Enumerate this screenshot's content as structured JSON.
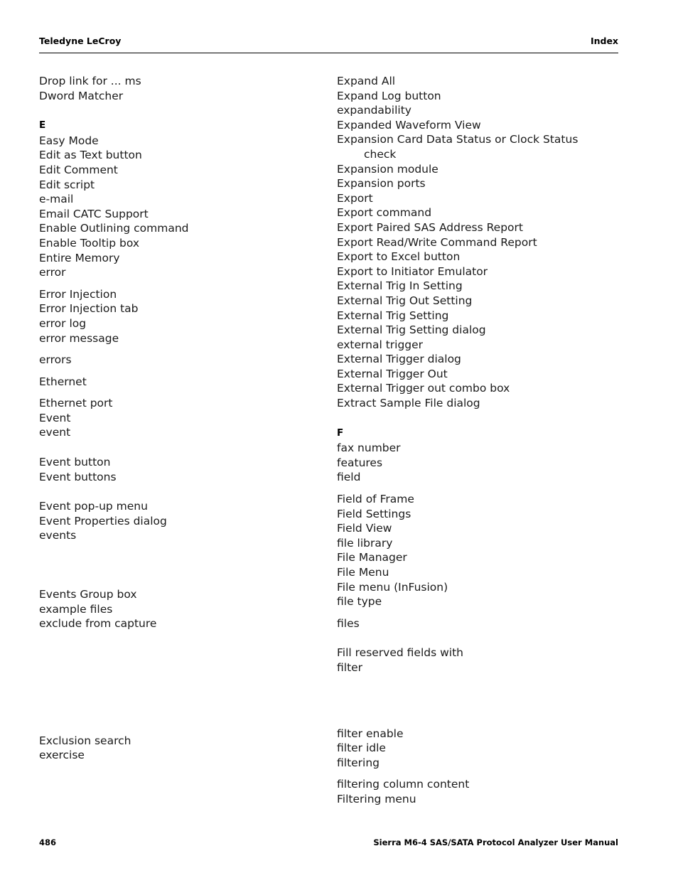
{
  "header": {
    "left": "Teledyne LeCroy",
    "right": "Index"
  },
  "footer": {
    "page_number": "486",
    "title": "Sierra M6-4 SAS/SATA Protocol Analyzer User Manual"
  },
  "left_column": [
    {
      "type": "entry",
      "text": "Drop link for ... ms"
    },
    {
      "type": "entry",
      "text": "Dword Matcher"
    },
    {
      "type": "letter",
      "text": "E"
    },
    {
      "type": "entry",
      "text": "Easy Mode"
    },
    {
      "type": "entry",
      "text": "Edit as Text button"
    },
    {
      "type": "entry",
      "text": "Edit Comment"
    },
    {
      "type": "entry",
      "text": "Edit script"
    },
    {
      "type": "entry",
      "text": "e-mail"
    },
    {
      "type": "entry",
      "text": "Email CATC Support"
    },
    {
      "type": "entry",
      "text": "Enable Outlining command"
    },
    {
      "type": "entry",
      "text": "Enable Tooltip box"
    },
    {
      "type": "entry",
      "text": "Entire Memory"
    },
    {
      "type": "entry",
      "text": "error"
    },
    {
      "type": "gap",
      "size": "gap-s"
    },
    {
      "type": "entry",
      "text": "Error Injection"
    },
    {
      "type": "entry",
      "text": "Error Injection tab"
    },
    {
      "type": "entry",
      "text": "error log"
    },
    {
      "type": "entry",
      "text": "error message"
    },
    {
      "type": "gap",
      "size": "gap-s"
    },
    {
      "type": "entry",
      "text": "errors"
    },
    {
      "type": "gap",
      "size": "gap-s"
    },
    {
      "type": "entry",
      "text": "Ethernet"
    },
    {
      "type": "gap",
      "size": "gap-s"
    },
    {
      "type": "entry",
      "text": "Ethernet port"
    },
    {
      "type": "entry",
      "text": "Event"
    },
    {
      "type": "entry",
      "text": "event"
    },
    {
      "type": "gap",
      "size": "gap-m"
    },
    {
      "type": "entry",
      "text": "Event button"
    },
    {
      "type": "entry",
      "text": "Event buttons"
    },
    {
      "type": "gap",
      "size": "gap-m"
    },
    {
      "type": "entry",
      "text": "Event pop-up menu"
    },
    {
      "type": "entry",
      "text": "Event Properties dialog"
    },
    {
      "type": "entry",
      "text": "events"
    },
    {
      "type": "gap",
      "size": "gap-xxl"
    },
    {
      "type": "entry",
      "text": "Events Group box"
    },
    {
      "type": "entry",
      "text": "example files"
    },
    {
      "type": "entry",
      "text": "exclude from capture"
    },
    {
      "type": "gap",
      "size": "gap-huge"
    },
    {
      "type": "gap",
      "size": "gap-m"
    },
    {
      "type": "entry",
      "text": "Exclusion search"
    },
    {
      "type": "entry",
      "text": "exercise"
    }
  ],
  "right_column": [
    {
      "type": "entry",
      "text": "Expand All"
    },
    {
      "type": "entry",
      "text": "Expand Log button"
    },
    {
      "type": "entry",
      "text": "expandability"
    },
    {
      "type": "entry",
      "text": "Expanded Waveform View"
    },
    {
      "type": "entry",
      "text": "Expansion Card Data Status or Clock Status"
    },
    {
      "type": "entry",
      "indent": true,
      "text": "check"
    },
    {
      "type": "entry",
      "text": "Expansion module"
    },
    {
      "type": "entry",
      "text": "Expansion ports"
    },
    {
      "type": "entry",
      "text": "Export"
    },
    {
      "type": "entry",
      "text": "Export command"
    },
    {
      "type": "entry",
      "text": "Export Paired SAS Address Report"
    },
    {
      "type": "entry",
      "text": "Export Read/Write Command Report"
    },
    {
      "type": "entry",
      "text": "Export to Excel button"
    },
    {
      "type": "entry",
      "text": "Export to Initiator Emulator"
    },
    {
      "type": "entry",
      "text": "External Trig In Setting"
    },
    {
      "type": "entry",
      "text": "External Trig Out Setting"
    },
    {
      "type": "entry",
      "text": "External Trig Setting"
    },
    {
      "type": "entry",
      "text": "External Trig Setting dialog"
    },
    {
      "type": "entry",
      "text": "external trigger"
    },
    {
      "type": "entry",
      "text": "External Trigger dialog"
    },
    {
      "type": "entry",
      "text": "External Trigger Out"
    },
    {
      "type": "entry",
      "text": "External Trigger out combo box"
    },
    {
      "type": "entry",
      "text": "Extract Sample File dialog"
    },
    {
      "type": "letter",
      "text": "F"
    },
    {
      "type": "entry",
      "text": "fax number"
    },
    {
      "type": "entry",
      "text": "features"
    },
    {
      "type": "entry",
      "text": "field"
    },
    {
      "type": "gap",
      "size": "gap-s"
    },
    {
      "type": "entry",
      "text": "Field of Frame"
    },
    {
      "type": "entry",
      "text": "Field Settings"
    },
    {
      "type": "entry",
      "text": "Field View"
    },
    {
      "type": "entry",
      "text": "file library"
    },
    {
      "type": "entry",
      "text": "File Manager"
    },
    {
      "type": "entry",
      "text": "File Menu"
    },
    {
      "type": "entry",
      "text": "File menu (InFusion)"
    },
    {
      "type": "entry",
      "text": "file type"
    },
    {
      "type": "gap",
      "size": "gap-s"
    },
    {
      "type": "entry",
      "text": "files"
    },
    {
      "type": "gap",
      "size": "gap-m"
    },
    {
      "type": "entry",
      "text": "Fill reserved fields with"
    },
    {
      "type": "entry",
      "text": "filter"
    },
    {
      "type": "gap",
      "size": "gap-xxl"
    },
    {
      "type": "gap",
      "size": "gap-s"
    },
    {
      "type": "entry",
      "text": "filter enable"
    },
    {
      "type": "entry",
      "text": "filter idle"
    },
    {
      "type": "entry",
      "text": "filtering"
    },
    {
      "type": "gap",
      "size": "gap-s"
    },
    {
      "type": "entry",
      "text": "filtering column content"
    },
    {
      "type": "entry",
      "text": "Filtering menu"
    }
  ]
}
